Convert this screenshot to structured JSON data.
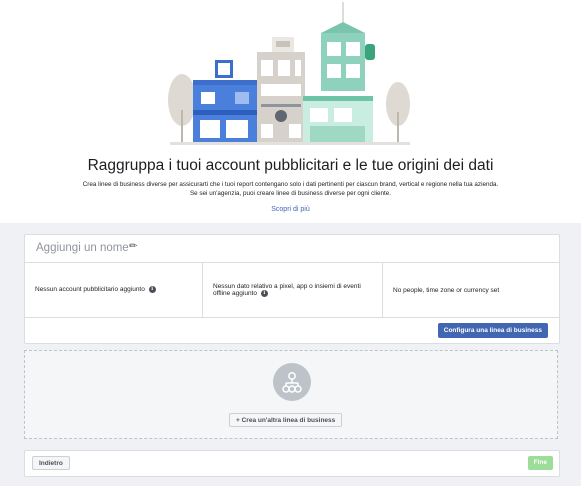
{
  "hero": {
    "title": "Raggruppa i tuoi account pubblicitari e le tue origini dei dati",
    "subtitle": "Crea linee di business diverse per assicurarti che i tuoi report contengano solo i dati pertinenti per ciascun brand, vertical e regione nella tua azienda. Se sei un'agenzia, puoi creare linee di business diverse per ogni cliente.",
    "learn_more": "Scopri di più"
  },
  "business_line": {
    "name_placeholder": "Aggiungi un nome",
    "ad_accounts": "Nessun account pubblicitario aggiunto",
    "data_sources": "Nessun dato relativo a pixel, app o insiemi di eventi offline aggiunto",
    "people": "No people, time zone or currency set",
    "configure_label": "Configura una linea di business"
  },
  "add_new": {
    "create_label": "Crea un'altra linea di business"
  },
  "footer": {
    "back_label": "Indietro",
    "done_label": "Fine"
  },
  "colors": {
    "accent": "#4267b2",
    "done_disabled": "#9cdd9a"
  }
}
